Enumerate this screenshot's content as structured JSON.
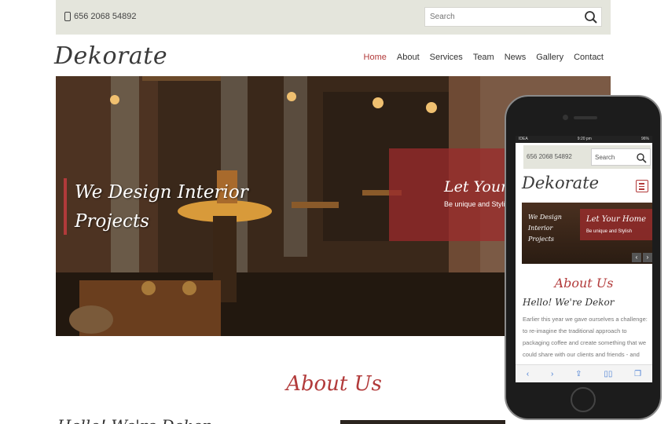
{
  "topbar": {
    "phone": "656 2068 54892",
    "search_placeholder": "Search"
  },
  "header": {
    "logo": "Dekorate",
    "nav": [
      {
        "label": "Home",
        "active": true
      },
      {
        "label": "About",
        "active": false
      },
      {
        "label": "Services",
        "active": false
      },
      {
        "label": "Team",
        "active": false
      },
      {
        "label": "News",
        "active": false
      },
      {
        "label": "Gallery",
        "active": false
      },
      {
        "label": "Contact",
        "active": false
      }
    ]
  },
  "hero": {
    "title": "We Design Interior Projects",
    "panel_title": "Let Your Home",
    "panel_subtitle": "Be unique and Stylish"
  },
  "about": {
    "title": "About Us",
    "subtitle": "Hello! We're Dekor"
  },
  "mobile": {
    "status_carrier": "IDEA",
    "status_time": "9:20 pm",
    "status_battery": "96%",
    "phone": "656 2068 54892",
    "search_placeholder": "Search",
    "logo": "Dekorate",
    "hero_text": "We Design Interior Projects",
    "panel_title": "Let Your Home",
    "panel_subtitle": "Be unique and Stylish",
    "about_title": "About Us",
    "about_subtitle": "Hello! We're Dekor",
    "about_body": "Earlier this year we gave ourselves a challenge: to re-imagine the traditional approach to packaging coffee and create something that we could share with our clients and friends - and we"
  },
  "colors": {
    "accent": "#b23a3a",
    "topbar_bg": "#e4e5dc"
  }
}
